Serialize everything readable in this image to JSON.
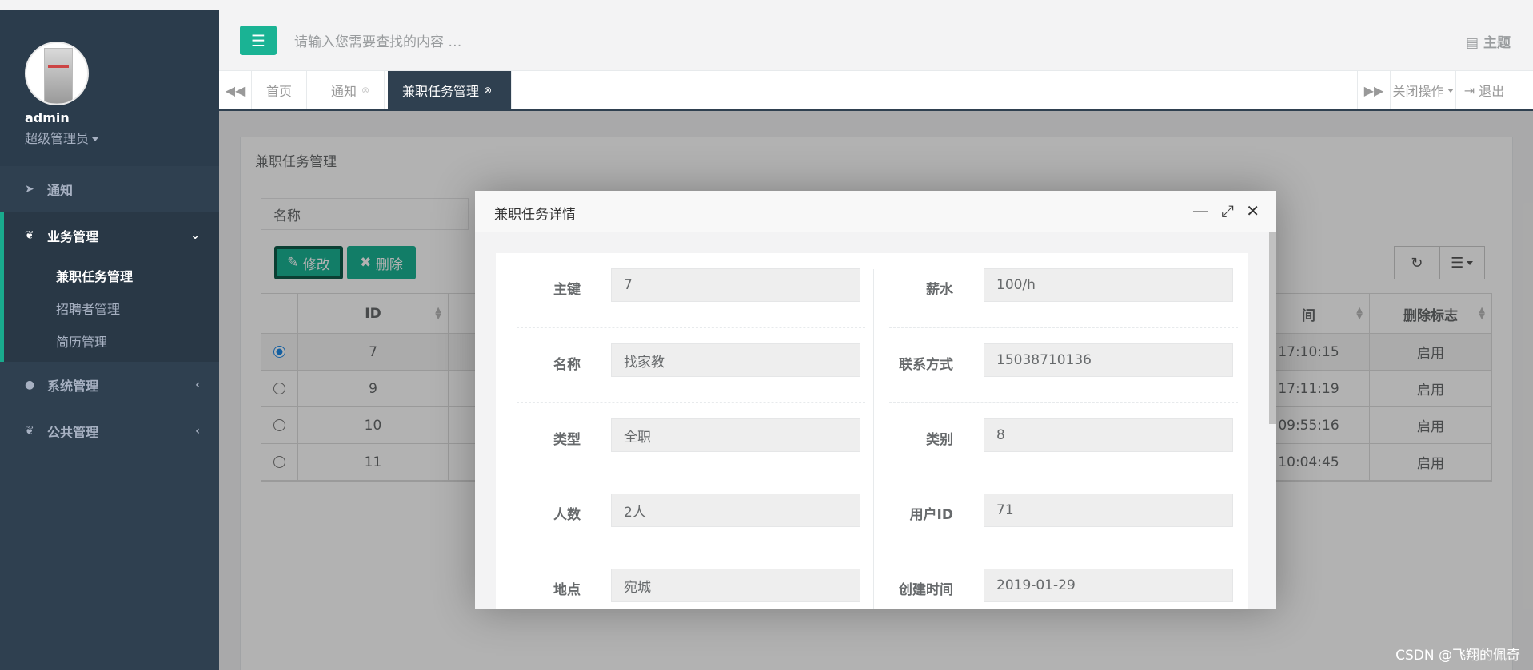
{
  "sidebar": {
    "user": "admin",
    "role": "超级管理员",
    "items": [
      {
        "label": "通知"
      },
      {
        "label": "业务管理",
        "sub": [
          "兼职任务管理",
          "招聘者管理",
          "简历管理"
        ]
      },
      {
        "label": "系统管理"
      },
      {
        "label": "公共管理"
      }
    ]
  },
  "topbar": {
    "search_placeholder": "请输入您需要查找的内容 …",
    "theme": "主题"
  },
  "tabs": {
    "items": [
      "首页",
      "通知",
      "兼职任务管理"
    ],
    "close_ops": "关闭操作",
    "logout": "退出"
  },
  "panel": {
    "title": "兼职任务管理",
    "filter_label": "名称",
    "edit_label": "修改",
    "delete_label": "删除",
    "columns": [
      "ID",
      "间",
      "删除标志"
    ],
    "rows": [
      {
        "id": "7",
        "time": "17:10:15",
        "flag": "启用"
      },
      {
        "id": "9",
        "time": "17:11:19",
        "flag": "启用"
      },
      {
        "id": "10",
        "time": "09:55:16",
        "flag": "启用"
      },
      {
        "id": "11",
        "time": "10:04:45",
        "flag": "启用"
      }
    ]
  },
  "modal": {
    "title": "兼职任务详情",
    "left": [
      {
        "label": "主键",
        "value": "7"
      },
      {
        "label": "名称",
        "value": "找家教"
      },
      {
        "label": "类型",
        "value": "全职"
      },
      {
        "label": "人数",
        "value": "2人"
      },
      {
        "label": "地点",
        "value": "宛城"
      }
    ],
    "right": [
      {
        "label": "薪水",
        "value": "100/h"
      },
      {
        "label": "联系方式",
        "value": "15038710136"
      },
      {
        "label": "类别",
        "value": "8"
      },
      {
        "label": "用户ID",
        "value": "71"
      },
      {
        "label": "创建时间",
        "value": "2019-01-29"
      }
    ]
  },
  "watermark": "CSDN @飞翔的佩奇"
}
